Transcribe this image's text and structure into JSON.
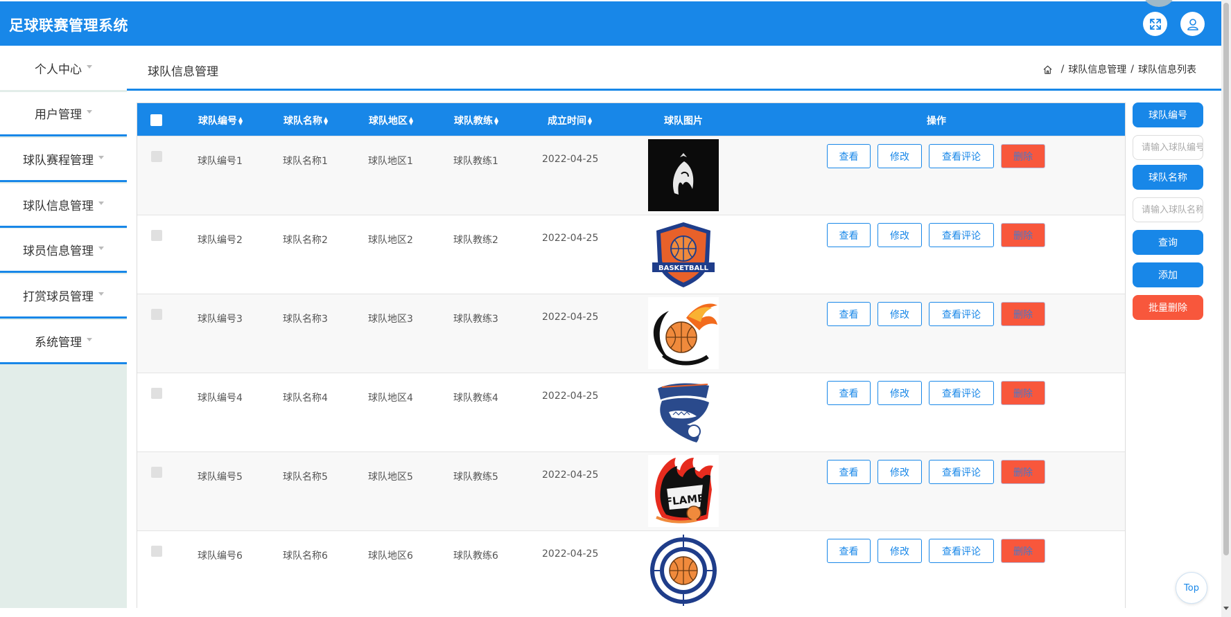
{
  "app": {
    "title": "足球联赛管理系统"
  },
  "sidebar": {
    "items": [
      {
        "label": "个人中心"
      },
      {
        "label": "用户管理"
      },
      {
        "label": "球队赛程管理"
      },
      {
        "label": "球队信息管理"
      },
      {
        "label": "球员信息管理"
      },
      {
        "label": "打赏球员管理"
      },
      {
        "label": "系统管理"
      }
    ]
  },
  "page": {
    "title": "球队信息管理",
    "breadcrumb": [
      "球队信息管理",
      "球队信息列表"
    ]
  },
  "table": {
    "headers": {
      "team_no": "球队编号",
      "team_name": "球队名称",
      "team_region": "球队地区",
      "team_coach": "球队教练",
      "founded": "成立时间",
      "team_image": "球队图片",
      "actions": "操作"
    },
    "rows": [
      {
        "team_no": "球队编号1",
        "team_name": "球队名称1",
        "team_region": "球队地区1",
        "team_coach": "球队教练1",
        "founded": "2022-04-25"
      },
      {
        "team_no": "球队编号2",
        "team_name": "球队名称2",
        "team_region": "球队地区2",
        "team_coach": "球队教练2",
        "founded": "2022-04-25"
      },
      {
        "team_no": "球队编号3",
        "team_name": "球队名称3",
        "team_region": "球队地区3",
        "team_coach": "球队教练3",
        "founded": "2022-04-25"
      },
      {
        "team_no": "球队编号4",
        "team_name": "球队名称4",
        "team_region": "球队地区4",
        "team_coach": "球队教练4",
        "founded": "2022-04-25"
      },
      {
        "team_no": "球队编号5",
        "team_name": "球队名称5",
        "team_region": "球队地区5",
        "team_coach": "球队教练5",
        "founded": "2022-04-25"
      },
      {
        "team_no": "球队编号6",
        "team_name": "球队名称6",
        "team_region": "球队地区6",
        "team_coach": "球队教练6",
        "founded": "2022-04-25"
      }
    ],
    "action_labels": {
      "view": "查看",
      "edit": "修改",
      "comment": "查看评论",
      "delete": "删除"
    }
  },
  "logos": {
    "basketball_text": "BASKETBALL",
    "flame_text": "FLAME"
  },
  "search": {
    "team_no_label": "球队编号",
    "team_no_placeholder": "请输入球队编号",
    "team_name_label": "球队名称",
    "team_name_placeholder": "请输入球队名称",
    "query_label": "查询",
    "add_label": "添加",
    "batch_delete_label": "批量删除"
  },
  "misc": {
    "top_label": "Top"
  },
  "colors": {
    "primary": "#1887e8",
    "danger": "#f8573c",
    "sidebar_bg": "#e2ede9"
  },
  "icons": {
    "expand": "fullscreen-icon",
    "user": "user-icon",
    "home": "home-icon",
    "sort": "sort-icon"
  }
}
